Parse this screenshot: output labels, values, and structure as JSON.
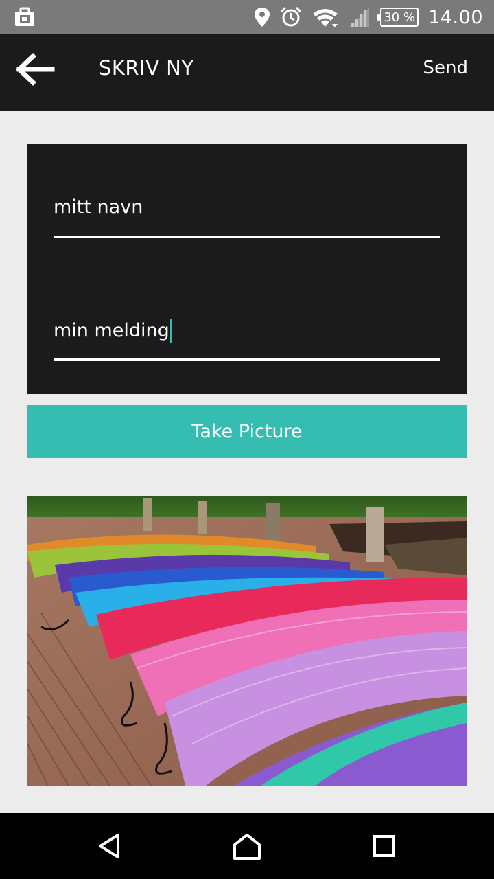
{
  "status_bar": {
    "time": "14.00",
    "battery": "30 %",
    "icons": [
      "briefcase-icon",
      "location-icon",
      "alarm-icon",
      "wifi-icon",
      "signal-icon",
      "battery-icon"
    ]
  },
  "app_bar": {
    "back_icon": "arrow-left-icon",
    "title": "SKRIV NY",
    "send_label": "Send"
  },
  "form": {
    "name_value": "mitt navn",
    "message_value": "min melding"
  },
  "take_picture_label": "Take Picture",
  "photo": {
    "subject": "colorful rowboats on a dock"
  },
  "nav_bar": {
    "icons": [
      "back-triangle-icon",
      "home-icon",
      "recents-icon"
    ]
  },
  "colors": {
    "accent": "#36bdb1",
    "app_bar": "#1b1b1b",
    "status_bar": "#7a7a7a",
    "background": "#ececec"
  }
}
